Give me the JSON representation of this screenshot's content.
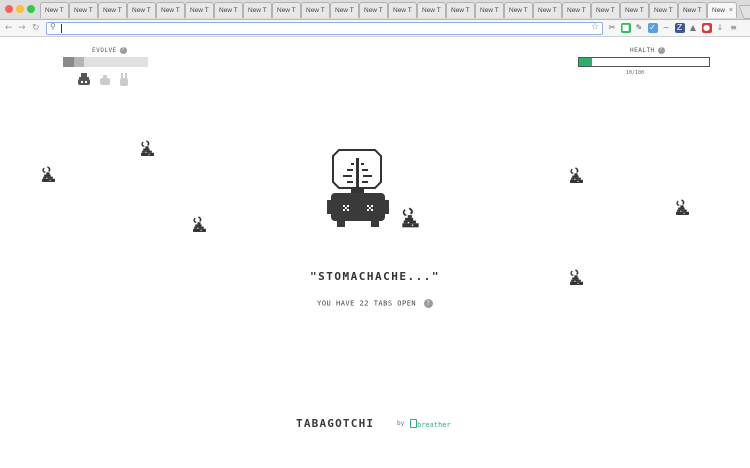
{
  "browser": {
    "tab_label": "New T",
    "active_tab_label": "New",
    "close_glyph": "×",
    "tab_count_visible": 23,
    "traffic_colors": [
      "#fc605c",
      "#fdbc40",
      "#34c84a"
    ],
    "url": "",
    "extensions": [
      {
        "name": "screenshot-ext-icon",
        "glyph": "✂",
        "color": "#6c6c6c"
      },
      {
        "name": "evernote-ext-icon",
        "glyph": "■",
        "color": "#2dbe60"
      },
      {
        "name": "eyedropper-ext-icon",
        "glyph": "✎",
        "color": "#555555"
      },
      {
        "name": "pocket-ext-icon",
        "glyph": "✓",
        "color": "#5aa0e0"
      },
      {
        "name": "wave-ext-icon",
        "glyph": "~",
        "color": "#777777"
      },
      {
        "name": "zotero-ext-icon",
        "glyph": "Z",
        "color": "#3b5998"
      },
      {
        "name": "honey-ext-icon",
        "glyph": "▲",
        "color": "#777777"
      },
      {
        "name": "lastpass-ext-icon",
        "glyph": "●",
        "color": "#d93b3b"
      },
      {
        "name": "download-ext-icon",
        "glyph": "↓",
        "color": "#888888"
      },
      {
        "name": "menu-icon",
        "glyph": "≡",
        "color": "#777777"
      }
    ]
  },
  "evolve": {
    "label": "EVOLVE",
    "segments_filled": 2,
    "segments_total": 8,
    "filled_colors": [
      "#8a8a8a",
      "#b5b5b5"
    ]
  },
  "health": {
    "label": "HEALTH",
    "value_text": "10/100",
    "fraction": 0.1,
    "fill_color": "#2eae6a"
  },
  "pet": {
    "status_text": "\"STOMACHACHE...\"",
    "tab_message": "YOU HAVE 22 TABS OPEN",
    "help_glyph": "?"
  },
  "footer": {
    "title": "TABAGOTCHI",
    "by": "by",
    "brand": "breather"
  }
}
